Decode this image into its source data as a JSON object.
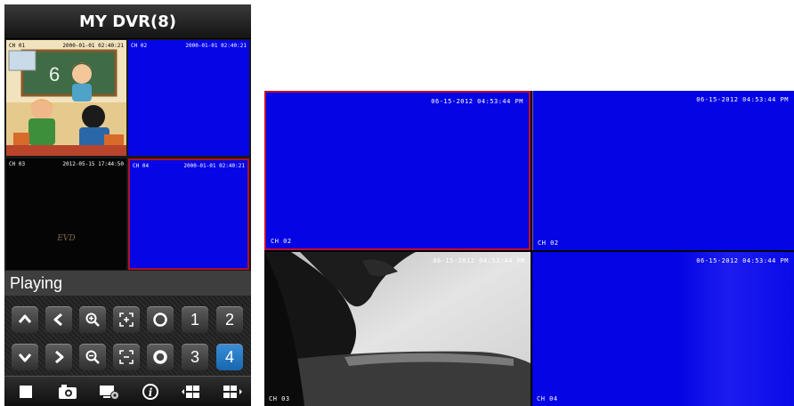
{
  "app": {
    "title": "MY DVR(8)",
    "status": "Playing"
  },
  "preview": {
    "cells": [
      {
        "channel": "CH 01",
        "timestamp": "2000-01-01 02:40:21"
      },
      {
        "channel": "CH 02",
        "timestamp": "2000-01-01 02:40:21"
      },
      {
        "channel": "CH 03",
        "timestamp": "2012-05-15 17:44:50",
        "watermark": "EVD"
      },
      {
        "channel": "CH 04",
        "timestamp": "2000-01-01 02:40:21"
      }
    ]
  },
  "controls": {
    "row1": [
      "up-arrow-icon",
      "left-arrow-icon",
      "zoom-in-icon",
      "focus-near-icon",
      "iris-open-icon",
      "1",
      "2"
    ],
    "row2": [
      "down-arrow-icon",
      "right-arrow-icon",
      "zoom-out-icon",
      "focus-far-icon",
      "iris-close-icon",
      "3",
      "4"
    ],
    "channel_buttons": [
      "1",
      "2",
      "3",
      "4"
    ],
    "active_channel": "4"
  },
  "bottom_bar": [
    "stop-icon",
    "snapshot-icon",
    "device-settings-icon",
    "info-icon",
    "previous-group-icon",
    "next-group-icon"
  ],
  "screen": {
    "cells": [
      {
        "channel": "CH 02",
        "timestamp": "06-15-2012 04:53:44 PM"
      },
      {
        "channel": "CH 02",
        "timestamp": "06-15-2012 04:53:44 PM"
      },
      {
        "channel": "CH 03",
        "timestamp": "06-15-2012 04:53:44 PM"
      },
      {
        "channel": "CH 04",
        "timestamp": "06-15-2012 04:53:44 PM"
      }
    ]
  },
  "colors": {
    "video_blue": "#0404e4",
    "selected_border": "#c01030",
    "active_button": "#1766b0"
  }
}
